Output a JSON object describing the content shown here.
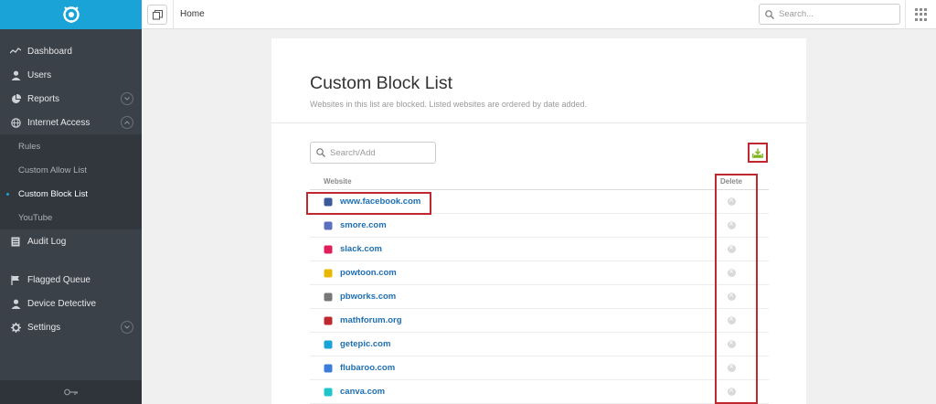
{
  "sidebar": {
    "items": [
      {
        "label": "Dashboard",
        "icon": "activity-icon"
      },
      {
        "label": "Users",
        "icon": "user-icon"
      },
      {
        "label": "Reports",
        "icon": "pie-chart-icon",
        "expandable": true
      },
      {
        "label": "Internet Access",
        "icon": "globe-icon",
        "expandable": true,
        "expanded": true
      }
    ],
    "sub_items": [
      {
        "label": "Rules"
      },
      {
        "label": "Custom Allow List"
      },
      {
        "label": "Custom Block List",
        "active": true
      },
      {
        "label": "YouTube"
      }
    ],
    "items_after": [
      {
        "label": "Audit Log",
        "icon": "document-icon"
      }
    ],
    "items_lower": [
      {
        "label": "Flagged Queue",
        "icon": "flag-icon"
      },
      {
        "label": "Device Detective",
        "icon": "user-icon"
      },
      {
        "label": "Settings",
        "icon": "gear-icon",
        "expandable": true
      }
    ],
    "footer_icon": "key-icon"
  },
  "topbar": {
    "breadcrumb": "Home",
    "search_placeholder": "Search..."
  },
  "page": {
    "title": "Custom Block List",
    "subtitle": "Websites in this list are blocked. Listed websites are ordered by date added.",
    "search_placeholder": "Search/Add",
    "columns": {
      "website": "Website",
      "delete": "Delete"
    },
    "rows": [
      {
        "site": "www.facebook.com",
        "favicon_color": "#3b5998",
        "icon": "facebook-icon"
      },
      {
        "site": "smore.com",
        "favicon_color": "#5b6fbf",
        "icon": "smore-icon"
      },
      {
        "site": "slack.com",
        "favicon_color": "#e01e5a",
        "icon": "slack-icon"
      },
      {
        "site": "powtoon.com",
        "favicon_color": "#e8b800",
        "icon": "powtoon-icon"
      },
      {
        "site": "pbworks.com",
        "favicon_color": "#777777",
        "icon": "pbworks-icon"
      },
      {
        "site": "mathforum.org",
        "favicon_color": "#c0282f",
        "icon": "mathforum-icon"
      },
      {
        "site": "getepic.com",
        "favicon_color": "#1aa3d6",
        "icon": "getepic-icon"
      },
      {
        "site": "flubaroo.com",
        "favicon_color": "#3b7dd8",
        "icon": "flubaroo-icon"
      },
      {
        "site": "canva.com",
        "favicon_color": "#20c4cb",
        "icon": "canva-icon"
      }
    ]
  },
  "colors": {
    "accent": "#1aa3d6",
    "sidebar_bg": "#3b4149",
    "link": "#1f6fb2",
    "highlight": "#c0282f",
    "export_icon": "#7cb518"
  }
}
